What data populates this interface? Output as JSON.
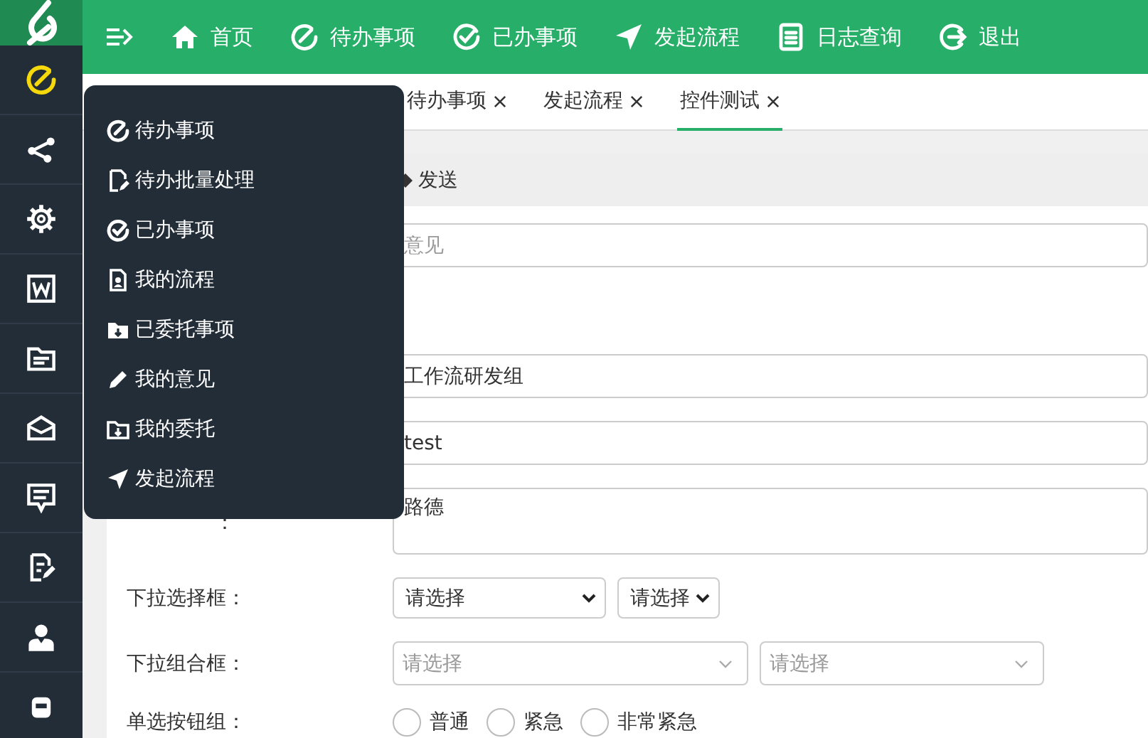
{
  "topbar": {
    "items": [
      {
        "label": "首页"
      },
      {
        "label": "待办事项"
      },
      {
        "label": "已办事项"
      },
      {
        "label": "发起流程"
      },
      {
        "label": "日志查询"
      },
      {
        "label": "退出"
      }
    ]
  },
  "sidebar": {
    "items": [
      {
        "selected": true
      },
      {
        "selected": false
      },
      {
        "selected": false
      },
      {
        "selected": false
      },
      {
        "selected": false
      },
      {
        "selected": false
      },
      {
        "selected": false
      },
      {
        "selected": false
      },
      {
        "selected": false
      },
      {
        "selected": false
      }
    ]
  },
  "popup_menu": {
    "items": [
      {
        "label": "待办事项"
      },
      {
        "label": "待办批量处理"
      },
      {
        "label": "已办事项"
      },
      {
        "label": "我的流程"
      },
      {
        "label": "已委托事项"
      },
      {
        "label": "我的意见"
      },
      {
        "label": "我的委托"
      },
      {
        "label": "发起流程"
      }
    ]
  },
  "tabs": [
    {
      "label": "待办事项",
      "selected": false
    },
    {
      "label": "发起流程",
      "selected": false
    },
    {
      "label": "控件测试",
      "selected": true
    }
  ],
  "toolbar": {
    "button": "发送"
  },
  "form": {
    "rows": [
      {
        "kind": "input",
        "placeholder": "意见"
      },
      {
        "kind": "input",
        "value": "工作流研发组"
      },
      {
        "kind": "input",
        "value": "test"
      },
      {
        "kind": "textarea",
        "label": "：",
        "value": "路德"
      },
      {
        "kind": "select",
        "label": "下拉选择框：",
        "selects": [
          "请选择",
          "请选择"
        ]
      },
      {
        "kind": "combo",
        "label": "下拉组合框：",
        "placeholders": [
          "请选择",
          "请选择"
        ]
      },
      {
        "kind": "radio",
        "label": "单选按钮组：",
        "options": [
          {
            "label": "普通",
            "selected": false
          },
          {
            "label": "紧急",
            "selected": false
          },
          {
            "label": "非常紧急",
            "selected": false
          }
        ]
      }
    ]
  }
}
